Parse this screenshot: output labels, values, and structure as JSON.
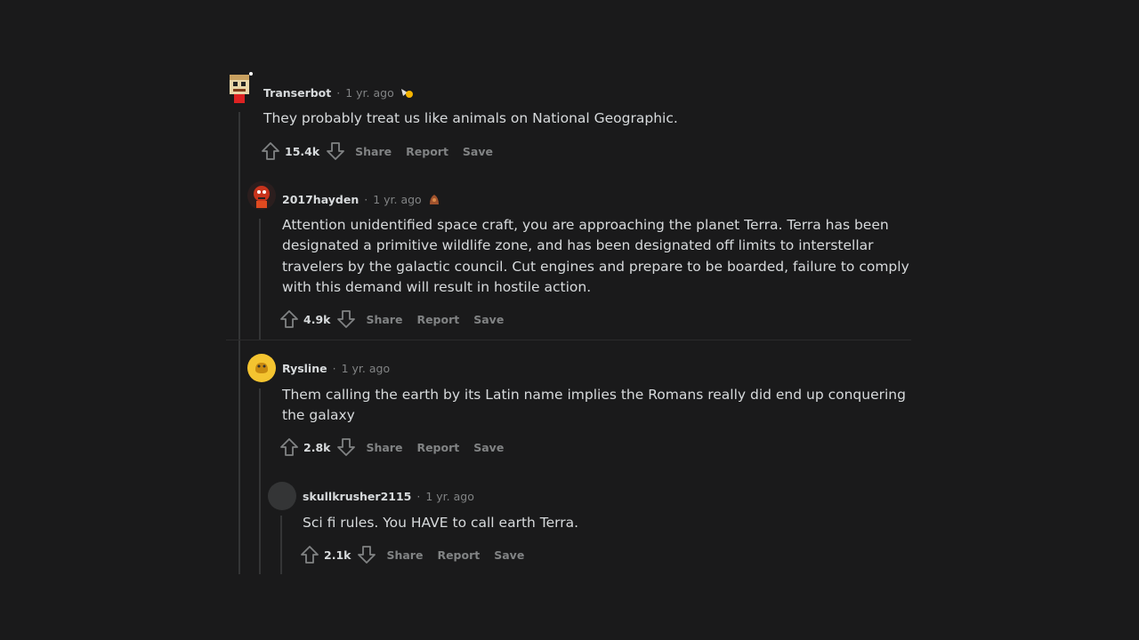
{
  "comments": [
    {
      "author": "Transerbot",
      "time": "1 yr. ago",
      "text": "They probably treat us like animals on National Geographic.",
      "score": "15.4k",
      "share": "Share",
      "report": "Report",
      "save": "Save"
    },
    {
      "author": "2017hayden",
      "time": "1 yr. ago",
      "text": "Attention unidentified space craft, you are approaching the planet Terra. Terra has been designated a primitive wildlife zone, and has been designated off limits to interstellar travelers by the galactic council. Cut engines and prepare to be boarded, failure to comply with this demand will result in hostile action.",
      "score": "4.9k",
      "share": "Share",
      "report": "Report",
      "save": "Save"
    },
    {
      "author": "Rysline",
      "time": "1 yr. ago",
      "text": "Them calling the earth by its Latin name implies the Romans really did end up conquering the galaxy",
      "score": "2.8k",
      "share": "Share",
      "report": "Report",
      "save": "Save"
    },
    {
      "author": "skullkrusher2115",
      "time": "1 yr. ago",
      "text": "Sci fi rules. You HAVE to call earth Terra.",
      "score": "2.1k",
      "share": "Share",
      "report": "Report",
      "save": "Save"
    }
  ],
  "separator": "·",
  "colors": {
    "background": "#1a1a1b",
    "text": "#d7dadc",
    "muted": "#818384",
    "thread": "#343536"
  }
}
